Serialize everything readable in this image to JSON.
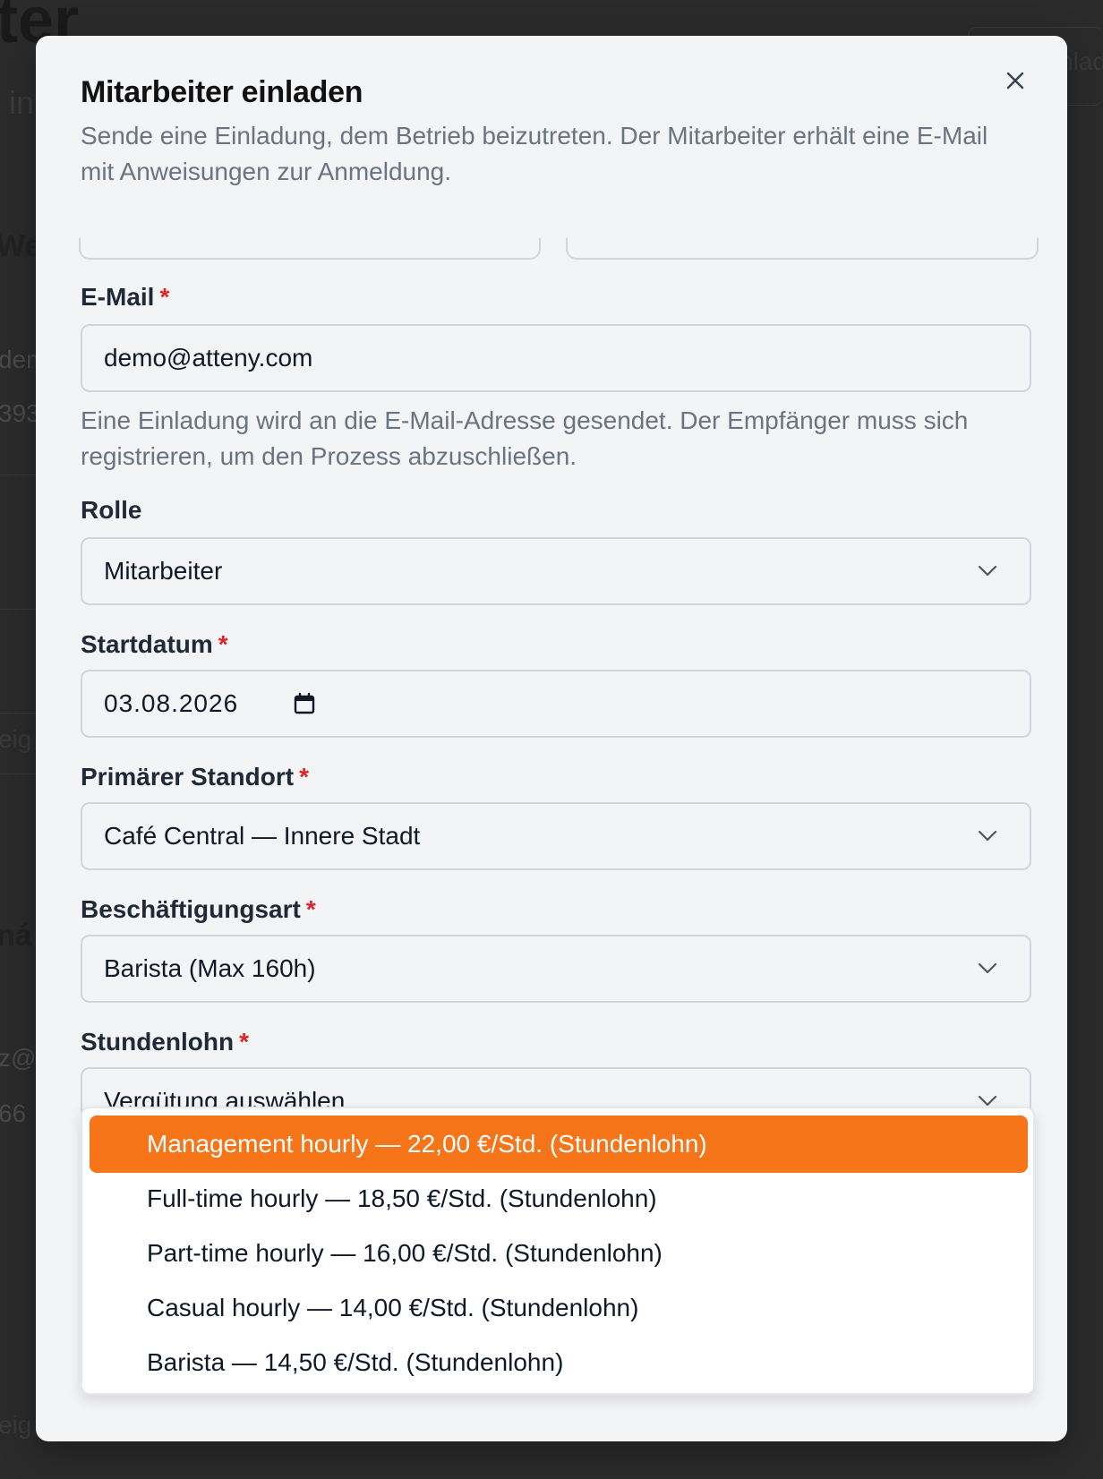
{
  "background": {
    "fragments": [
      "ter",
      "in",
      "Web",
      "dem",
      "393",
      "eig",
      "ná",
      "z@",
      "66",
      "eig",
      "nlad"
    ]
  },
  "modal": {
    "title": "Mitarbeiter einladen",
    "description": "Sende eine Einladung, dem Betrieb beizutreten. Der Mitarbeiter erhält eine E-Mail mit Anweisungen zur Anmeldung.",
    "close_icon": "close-icon"
  },
  "form": {
    "email": {
      "label": "E-Mail",
      "required_mark": "*",
      "value": "demo@atteny.com",
      "hint": "Eine Einladung wird an die E-Mail-Adresse gesendet. Der Empfänger muss sich registrieren, um den Prozess abzuschließen."
    },
    "role": {
      "label": "Rolle",
      "value": "Mitarbeiter"
    },
    "start_date": {
      "label": "Startdatum",
      "required_mark": "*",
      "value": "03.08.2026",
      "icon": "calendar-icon"
    },
    "location": {
      "label": "Primärer Standort",
      "required_mark": "*",
      "value": "Café Central — Innere Stadt"
    },
    "employment_type": {
      "label": "Beschäftigungsart",
      "required_mark": "*",
      "value": "Barista (Max 160h)"
    },
    "wage": {
      "label": "Stundenlohn",
      "required_mark": "*",
      "placeholder": "Vergütung auswählen...",
      "options": [
        "Management hourly — 22,00 €/Std. (Stundenlohn)",
        "Full-time hourly — 18,50 €/Std. (Stundenlohn)",
        "Part-time hourly — 16,00 €/Std. (Stundenlohn)",
        "Casual hourly — 14,00 €/Std. (Stundenlohn)",
        "Barista — 14,50 €/Std. (Stundenlohn)"
      ],
      "highlighted_index": 0
    }
  },
  "colors": {
    "accent": "#f77519",
    "required": "#dc2626",
    "overlay": "#2b2b2b",
    "modal_bg": "#f3f4f6"
  }
}
